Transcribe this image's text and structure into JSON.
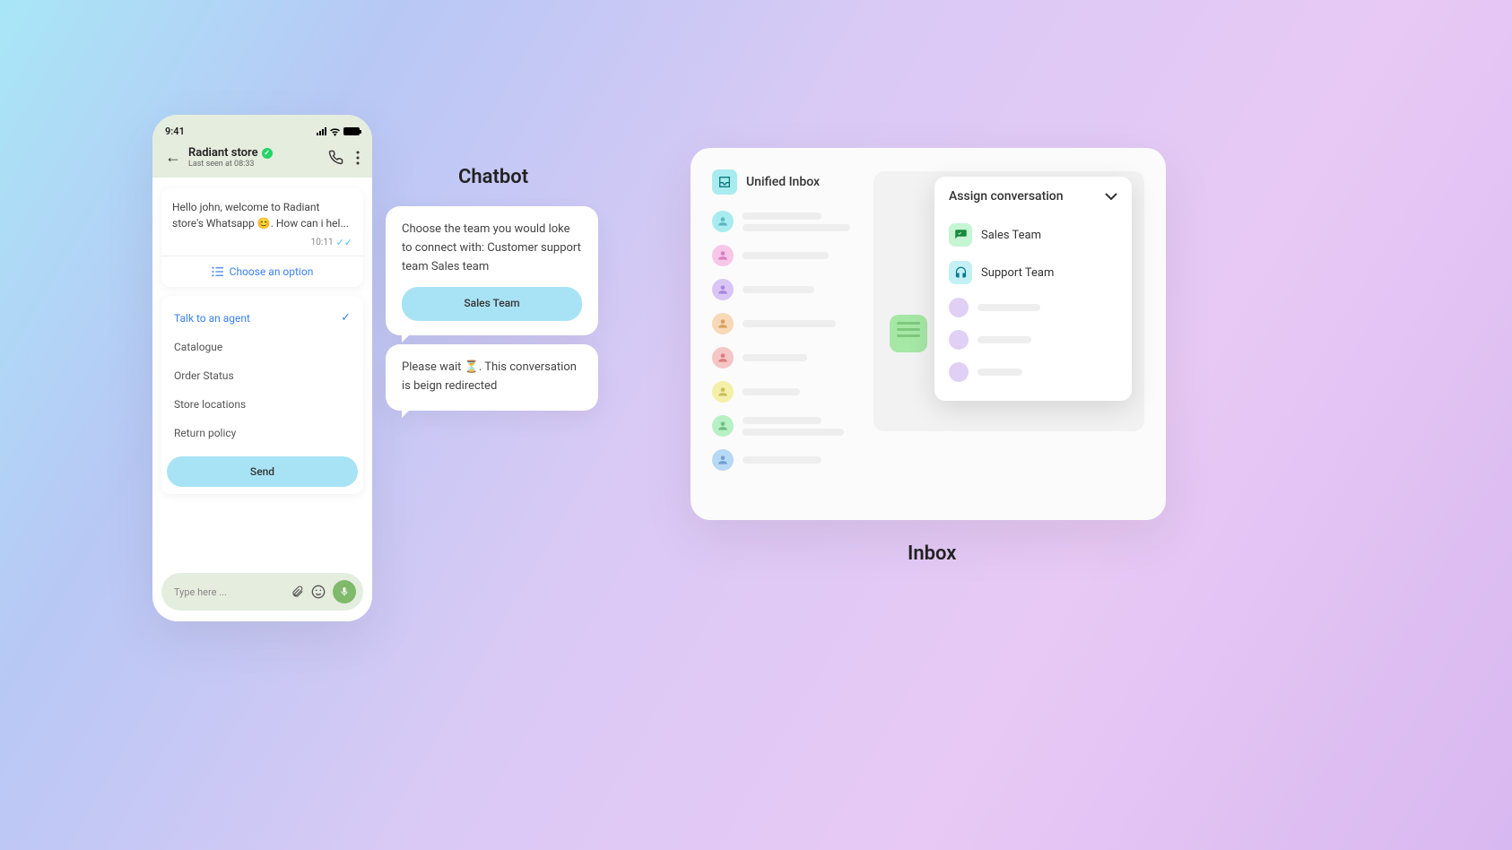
{
  "phone": {
    "status_time": "9:41",
    "contact_name": "Radiant store",
    "last_seen": "Last seen at 08:33",
    "welcome_msg": "Hello john, welcome to Radiant store's Whatsapp 😊. How can i hel...",
    "msg_time": "10:11",
    "choose_option": "Choose an option",
    "options": {
      "talk_agent": "Talk to an agent",
      "catalogue": "Catalogue",
      "order_status": "Order Status",
      "store_locations": "Store locations",
      "return_policy": "Return policy"
    },
    "send_label": "Send",
    "input_placeholder": "Type here ..."
  },
  "chatbot": {
    "title": "Chatbot",
    "bubble1_text": "Choose the team you would loke to connect with: Customer support team Sales team",
    "bubble1_btn": "Sales Team",
    "bubble2_text": "Please wait ⏳. This conversation is beign redirected"
  },
  "inbox": {
    "title": "Unified Inbox",
    "assign_label": "Assign conversation",
    "team_sales": "Sales Team",
    "team_support": "Support Team",
    "label": "Inbox"
  }
}
